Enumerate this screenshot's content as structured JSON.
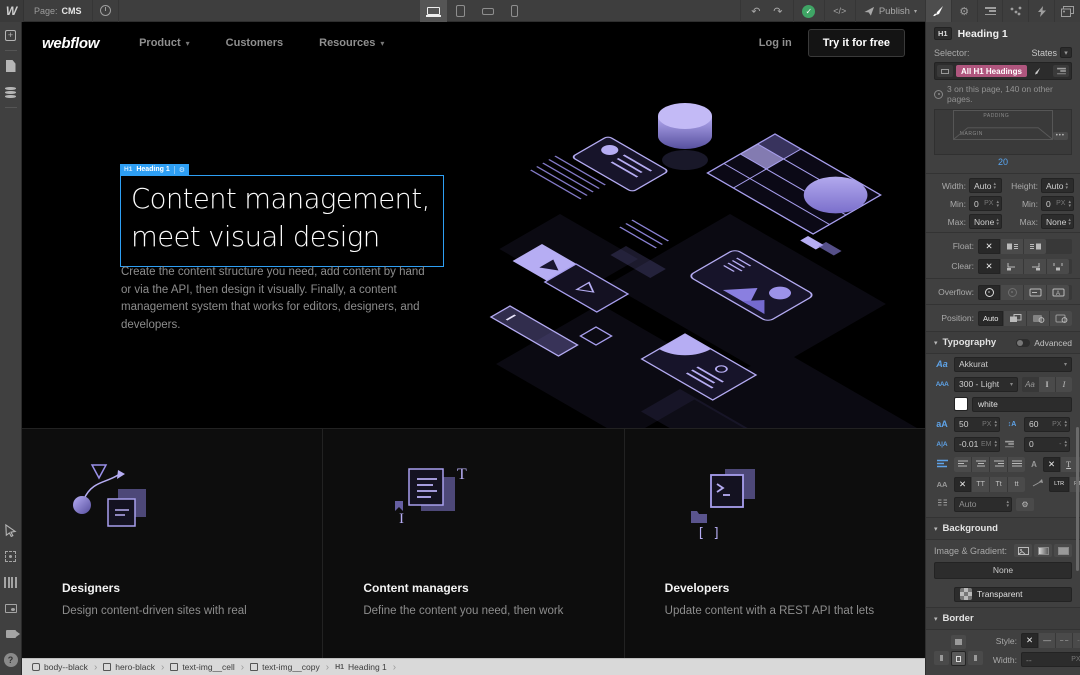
{
  "colors": {
    "accent_blue": "#2e9ff4",
    "selector_pink": "#b0567e",
    "illustration_purple": "#9a90ea",
    "publish_green": "#3fa565"
  },
  "glyphs": {
    "undo": "↶",
    "redo": "↷",
    "check": "✓",
    "code": "</>",
    "caret": "▾",
    "gear": "⚙",
    "plus": "+",
    "question": "?",
    "dots": "•••",
    "x": "✕",
    "up": "▴",
    "down": "▾",
    "solid": "—",
    "dashed": "– –",
    "dotted": "····",
    "sep": "›"
  },
  "topbar": {
    "logo": "W",
    "page_label": "Page:",
    "page_name": "CMS",
    "publish_label": "Publish"
  },
  "canvas": {
    "nav": {
      "brand": "webflow",
      "item1": "Product",
      "item2": "Customers",
      "item3": "Resources",
      "login": "Log in",
      "cta": "Try it for free"
    },
    "hero": {
      "badge_tag": "H1",
      "badge_label": "Heading 1",
      "heading_line1": "Content management,",
      "heading_line2": "meet visual design",
      "paragraph": "Create the content structure you need, add content by hand or via the API, then design it visually. Finally, a content management system that works for editors, designers, and developers."
    },
    "features": [
      {
        "title": "Designers",
        "text": "Design content-driven sites with real"
      },
      {
        "title": "Content managers",
        "text": "Define the content you need, then work"
      },
      {
        "title": "Developers",
        "text": "Update content with a REST API that lets"
      }
    ]
  },
  "panel": {
    "element_tag": "H1",
    "element_name": "Heading 1",
    "selector_label": "Selector:",
    "states_label": "States",
    "selector_value": "All H1 Headings",
    "usage": "3 on this page, 140 on other pages.",
    "spacing": {
      "padding": "PADDING",
      "margin": "MARGIN",
      "value": "20"
    },
    "dims": {
      "width_label": "Width:",
      "height_label": "Height:",
      "min_label": "Min:",
      "max_label": "Max:",
      "width": "Auto",
      "height": "Auto",
      "min_w": "0",
      "min_h": "0",
      "max_w": "None",
      "max_h": "None",
      "px": "PX"
    },
    "layout": {
      "float_label": "Float:",
      "clear_label": "Clear:",
      "overflow_label": "Overflow:",
      "position_label": "Position:",
      "position_value": "Auto"
    },
    "typography": {
      "title": "Typography",
      "advanced": "Advanced",
      "font_icon": "Aa",
      "weight_icon": "AAA",
      "font": "Akkurat",
      "weight": "300 - Light",
      "style_aa": "Aa",
      "style_i": "I",
      "color_name": "white",
      "size_icon": "aA",
      "size": "50",
      "px": "PX",
      "line_height": "60",
      "ls_icon": "A|A",
      "ls_value": "-0.01",
      "em": "EM",
      "indent": "0",
      "dec_a": "A",
      "dec_t": "T",
      "caps_icon": "AA",
      "caps_tt": "TT",
      "caps_tc": "Tt",
      "caps_lc": "tt",
      "ltr": "LTR",
      "rtl": "RTL",
      "columns": "Auto"
    },
    "background": {
      "title": "Background",
      "image_label": "Image & Gradient:",
      "none": "None",
      "transparent": "Transparent"
    },
    "border": {
      "title": "Border",
      "style_label": "Style:",
      "width_label": "Width:",
      "width_value": "--",
      "px": "PX"
    }
  },
  "breadcrumbs": {
    "items": [
      {
        "label": "body--black"
      },
      {
        "label": "hero-black"
      },
      {
        "label": "text-img__cell"
      },
      {
        "label": "text-img__copy"
      },
      {
        "tag": "H1",
        "label": "Heading 1"
      }
    ]
  }
}
